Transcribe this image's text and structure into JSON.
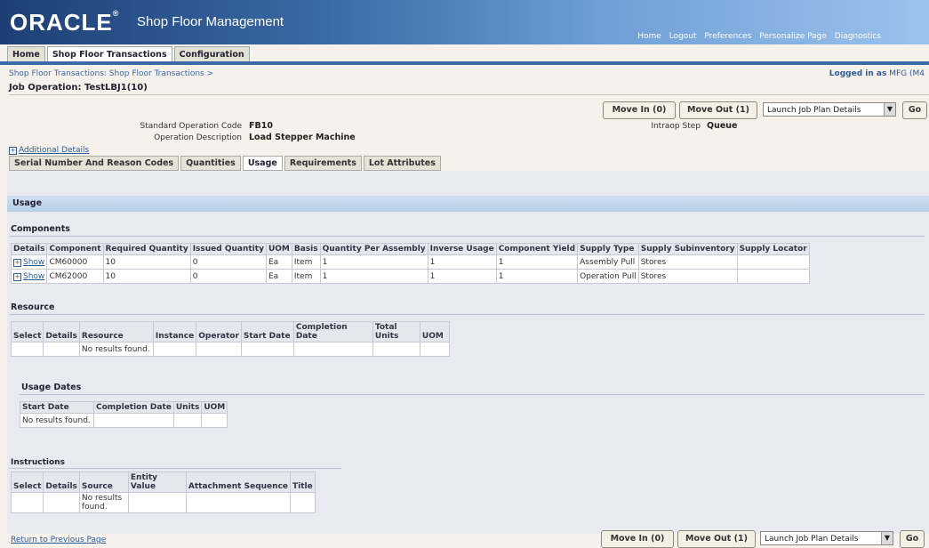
{
  "header": {
    "brand": "ORACLE",
    "app_title": "Shop Floor Management",
    "global_links": [
      "Home",
      "Logout",
      "Preferences",
      "Personalize Page",
      "Diagnostics"
    ]
  },
  "tabs": [
    "Home",
    "Shop Floor Transactions",
    "Configuration"
  ],
  "breadcrumb": "Shop Floor Transactions: Shop Floor Transactions >",
  "logged_in_label": "Logged in as",
  "logged_in_user": "MFG (M4",
  "page_title": "Job Operation: TestLBJ1(10)",
  "actions": {
    "move_in": "Move In (0)",
    "move_out": "Move Out (1)",
    "launch_select": "Launch Job Plan Details",
    "go": "Go"
  },
  "details": {
    "std_op_label": "Standard Operation Code",
    "std_op_value": "FB10",
    "op_desc_label": "Operation Description",
    "op_desc_value": "Load Stepper Machine",
    "intraop_label": "Intraop Step",
    "intraop_value": "Queue",
    "additional": "Additional Details"
  },
  "subtabs": [
    "Serial Number And Reason Codes",
    "Quantities",
    "Usage",
    "Requirements",
    "Lot Attributes"
  ],
  "usage_header": "Usage",
  "components": {
    "title": "Components",
    "columns": [
      "Details",
      "Component",
      "Required Quantity",
      "Issued Quantity",
      "UOM",
      "Basis",
      "Quantity Per Assembly",
      "Inverse Usage",
      "Component Yield",
      "Supply Type",
      "Supply Subinventory",
      "Supply Locator"
    ],
    "rows": [
      {
        "details": "Show",
        "component": "CM60000",
        "required": "10",
        "issued": "0",
        "uom": "Ea",
        "basis": "Item",
        "qpa": "1",
        "inverse": "1",
        "yield": "1",
        "supply_type": "Assembly Pull",
        "subinv": "Stores",
        "locator": ""
      },
      {
        "details": "Show",
        "component": "CM62000",
        "required": "10",
        "issued": "0",
        "uom": "Ea",
        "basis": "Item",
        "qpa": "1",
        "inverse": "1",
        "yield": "1",
        "supply_type": "Operation Pull",
        "subinv": "Stores",
        "locator": ""
      }
    ]
  },
  "resource": {
    "title": "Resource",
    "columns": [
      "Select",
      "Details",
      "Resource",
      "Instance",
      "Operator",
      "Start Date",
      "Completion Date",
      "Total Units",
      "UOM"
    ],
    "empty": "No results found."
  },
  "usage_dates": {
    "title": "Usage Dates",
    "columns": [
      "Start Date",
      "Completion Date",
      "Units",
      "UOM"
    ],
    "empty": "No results found."
  },
  "instructions": {
    "title": "Instructions",
    "columns": [
      "Select",
      "Details",
      "Source",
      "Entity Value",
      "Attachment Sequence",
      "Title"
    ],
    "empty": "No results found."
  },
  "footer": {
    "return_link": "Return to Previous Page"
  }
}
